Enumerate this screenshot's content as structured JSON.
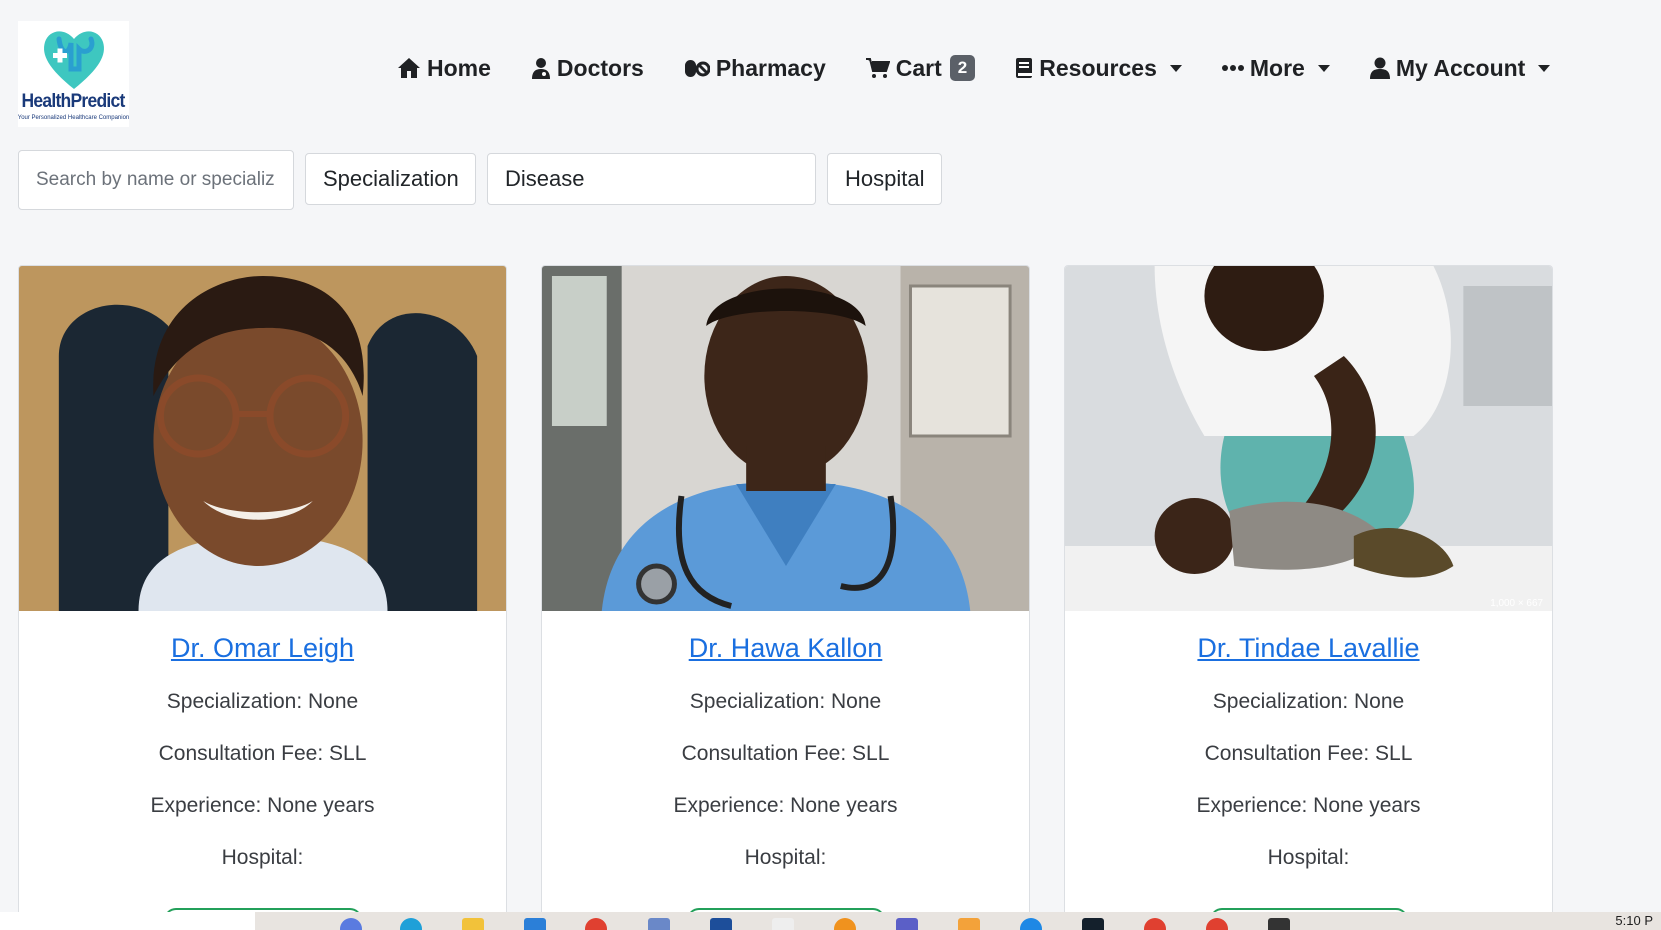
{
  "brand": {
    "name": "HealthPredict",
    "tagline": "Your Personalized Healthcare Companion"
  },
  "nav": [
    {
      "label": "Home",
      "icon": "home-icon"
    },
    {
      "label": "Doctors",
      "icon": "doctor-icon"
    },
    {
      "label": "Pharmacy",
      "icon": "pills-icon"
    },
    {
      "label": "Cart",
      "icon": "cart-icon",
      "badge": "2"
    },
    {
      "label": "Resources",
      "icon": "book-icon",
      "dropdown": true
    },
    {
      "label": "More",
      "icon": "ellipsis-icon",
      "dropdown": true
    },
    {
      "label": "My Account",
      "icon": "user-icon",
      "dropdown": true
    }
  ],
  "filters": {
    "search_placeholder": "Search by name or specializ",
    "specialization": "Specialization",
    "disease": "Disease",
    "hospital": "Hospital"
  },
  "doctors": [
    {
      "name": "Dr. Omar Leigh",
      "specialization": "Specialization: None",
      "fee": "Consultation Fee: SLL",
      "experience": "Experience: None years",
      "hospital": "Hospital:"
    },
    {
      "name": "Dr. Hawa Kallon",
      "specialization": "Specialization: None",
      "fee": "Consultation Fee: SLL",
      "experience": "Experience: None years",
      "hospital": "Hospital:"
    },
    {
      "name": "Dr. Tindae Lavallie",
      "specialization": "Specialization: None",
      "fee": "Consultation Fee: SLL",
      "experience": "Experience: None years",
      "hospital": "Hospital:",
      "image_caption": "1,000 × 667"
    }
  ],
  "taskbar": {
    "time": "5:10 P"
  },
  "colors": {
    "link": "#1a6fe0",
    "badge": "#5b6068",
    "accent_green": "#23a05a",
    "logo_teal": "#3ec7c0",
    "logo_navy": "#1a3a7a"
  }
}
